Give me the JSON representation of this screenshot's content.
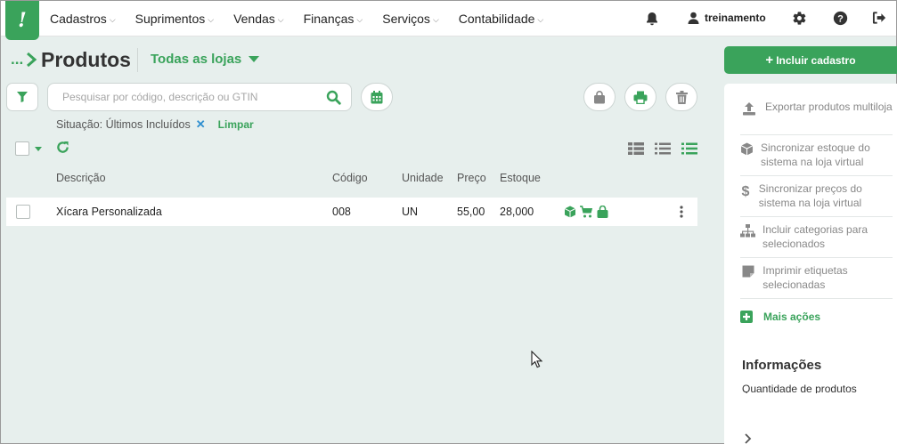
{
  "nav": {
    "logo": "!",
    "items": [
      "Cadastros",
      "Suprimentos",
      "Vendas",
      "Finanças",
      "Serviços",
      "Contabilidade"
    ],
    "user": "treinamento"
  },
  "page": {
    "breadcrumb": "...",
    "title": "Produtos",
    "store_filter": "Todas as lojas"
  },
  "search": {
    "placeholder": "Pesquisar por código, descrição ou GTIN"
  },
  "filters": {
    "active": "Situação: Últimos Incluídos",
    "clear_label": "Limpar"
  },
  "table": {
    "headers": [
      "Descrição",
      "Código",
      "Unidade",
      "Preço",
      "Estoque"
    ],
    "rows": [
      {
        "descricao": "Xícara Personalizada",
        "codigo": "008",
        "unidade": "UN",
        "preco": "55,00",
        "estoque": "28,000"
      }
    ]
  },
  "side": {
    "primary_button": "Incluir cadastro",
    "actions": [
      {
        "label": "Exportar produtos multiloja",
        "icon": "upload-icon"
      },
      {
        "label": "Sincronizar estoque do sistema na loja virtual",
        "icon": "box-icon"
      },
      {
        "label": "Sincronizar preços do sistema na loja virtual",
        "icon": "dollar-icon"
      },
      {
        "label": "Incluir categorias para selecionados",
        "icon": "sitemap-icon"
      },
      {
        "label": "Imprimir etiquetas selecionadas",
        "icon": "sticky-note-icon"
      }
    ],
    "more_actions": "Mais ações",
    "info_title": "Informações",
    "info_sub": "Quantidade de produtos"
  },
  "colors": {
    "accent": "#3aa35b",
    "background": "#e7efed",
    "link_x": "#2f8fd0"
  }
}
